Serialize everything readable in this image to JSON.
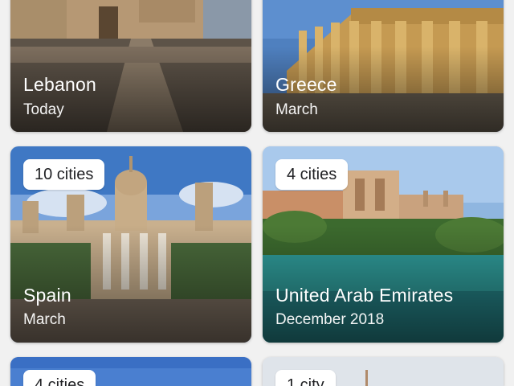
{
  "cards": [
    {
      "title": "Lebanon",
      "subtitle": "Today"
    },
    {
      "title": "Greece",
      "subtitle": "March"
    },
    {
      "title": "Spain",
      "subtitle": "March",
      "badge": "10 cities"
    },
    {
      "title": "United Arab Emirates",
      "subtitle": "December 2018",
      "badge": "4 cities"
    },
    {
      "badge": "4 cities"
    },
    {
      "badge": "1 city"
    }
  ]
}
